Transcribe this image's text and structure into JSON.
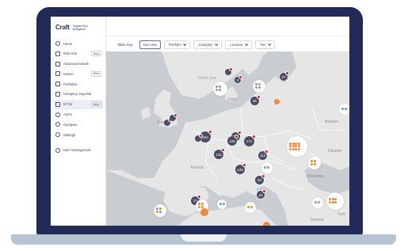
{
  "brand": {
    "logo": "Craft",
    "tagline": "Supplier Risk Intelligence"
  },
  "sidebar": {
    "items": [
      {
        "label": "Home",
        "icon": "home-icon",
        "badge": ""
      },
      {
        "label": "Risk Hub",
        "icon": "risk-hub-icon",
        "badge": "Beta"
      },
      {
        "label": "Advanced search",
        "icon": "advanced-search-icon",
        "badge": ""
      },
      {
        "label": "Cases",
        "icon": "cases-icon",
        "badge": "Beta"
      },
      {
        "label": "Portfolios",
        "icon": "portfolios-icon",
        "badge": ""
      },
      {
        "label": "Company requests",
        "icon": "company-requests-icon",
        "badge": ""
      },
      {
        "label": "N-Tier",
        "icon": "n-tier-icon",
        "badge": "Beta",
        "active": true
      },
      {
        "label": "Alerts",
        "icon": "alerts-icon",
        "badge": ""
      },
      {
        "label": "Compare",
        "icon": "compare-icon",
        "badge": ""
      },
      {
        "label": "Settings",
        "icon": "settings-icon",
        "badge": ""
      }
    ],
    "footer_item": {
      "label": "User management",
      "icon": "user-management-icon"
    }
  },
  "toolbar": {
    "table_view": "Table view",
    "geo_view": "Geo view",
    "filters": [
      "Portfolio",
      "Company",
      "Location",
      "Tier"
    ]
  },
  "map": {
    "labels": {
      "north_sea": "North Sea",
      "kingdom": "Kingdom",
      "france": "France",
      "belarus": "Belarus",
      "ukraine": "Ukraine",
      "romania": "Romania",
      "greece": "Greece",
      "turkey": "Turk",
      "den": "Den"
    },
    "clusters": [
      "27",
      "3",
      "66",
      "25",
      "254",
      "125",
      "172",
      "133",
      "113",
      "135",
      "30",
      "24",
      "37"
    ],
    "colors": {
      "cluster": "#4a4d63",
      "alert": "#c8202e",
      "orange": "#f08a3a",
      "blue": "#5b9ee6",
      "land": "#e6e6e6",
      "sea": "#c5c9ce"
    }
  },
  "map_tools": [
    "draw-line-icon",
    "expand-icon",
    "zoom-in-icon",
    "zoom-out-icon",
    "reset-icon"
  ]
}
